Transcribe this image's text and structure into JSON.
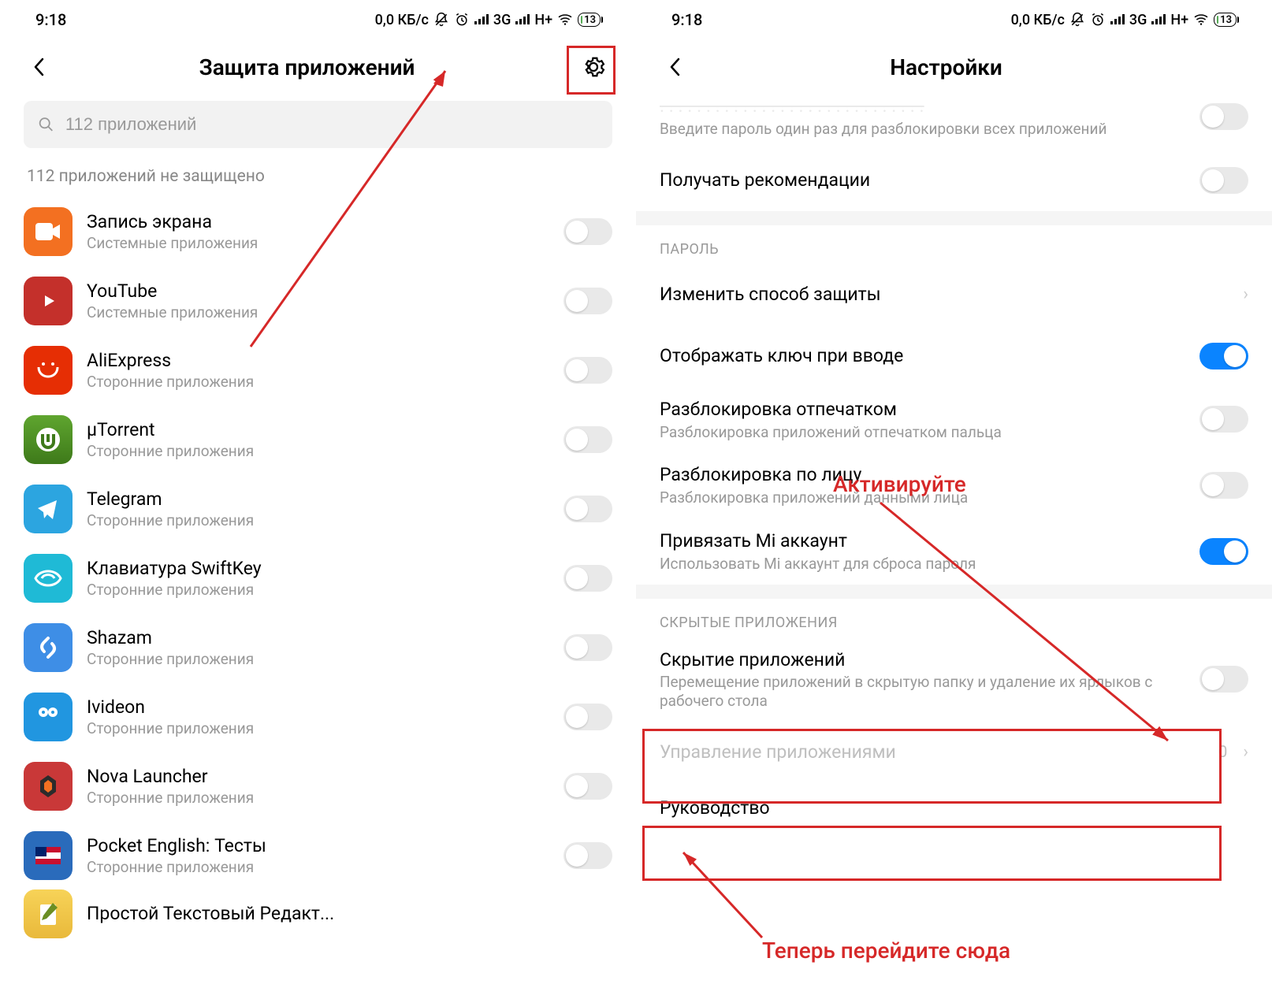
{
  "status": {
    "time": "9:18",
    "data_rate": "0,0 КБ/с",
    "signal_1": "3G",
    "signal_2": "H+",
    "battery": "13"
  },
  "left": {
    "title": "Защита приложений",
    "search_placeholder": "112 приложений",
    "unprotected_label": "112 приложений не защищено",
    "apps": [
      {
        "name": "Запись экрана",
        "category": "Системные приложения"
      },
      {
        "name": "YouTube",
        "category": "Системные приложения"
      },
      {
        "name": "AliExpress",
        "category": "Сторонние приложения"
      },
      {
        "name": "µTorrent",
        "category": "Сторонние приложения"
      },
      {
        "name": "Telegram",
        "category": "Сторонние приложения"
      },
      {
        "name": "Клавиатура SwiftKey",
        "category": "Сторонние приложения"
      },
      {
        "name": "Shazam",
        "category": "Сторонние приложения"
      },
      {
        "name": "Ivideon",
        "category": "Сторонние приложения"
      },
      {
        "name": "Nova Launcher",
        "category": "Сторонние приложения"
      },
      {
        "name": "Pocket English: Тесты",
        "category": "Сторонние приложения"
      },
      {
        "name": "Простой Текстовый Редакт...",
        "category": ""
      }
    ]
  },
  "right": {
    "title": "Настройки",
    "partial_sub": "Введите пароль один раз для разблокировки всех приложений",
    "recommendations": "Получать рекомендации",
    "section_password": "ПАРОЛЬ",
    "change_method": "Изменить способ защиты",
    "show_key": "Отображать ключ при вводе",
    "fingerprint_title": "Разблокировка отпечатком",
    "fingerprint_sub": "Разблокировка приложений отпечатком пальца",
    "face_title": "Разблокировка по лицу",
    "face_sub": "Разблокировка приложений данными лица",
    "mi_title": "Привязать Mi аккаунт",
    "mi_sub": "Использовать Mi аккаунт для сброса пароля",
    "section_hidden": "СКРЫТЫЕ ПРИЛОЖЕНИЯ",
    "hide_title": "Скрытие приложений",
    "hide_sub": "Перемещение приложений в скрытую папку и удаление их ярлыков с рабочего стола",
    "manage_apps": "Управление приложениями",
    "manage_value": "0",
    "guide": "Руководство"
  },
  "annotations": {
    "activate": "Активируйте",
    "goto": "Теперь перейдите сюда"
  }
}
